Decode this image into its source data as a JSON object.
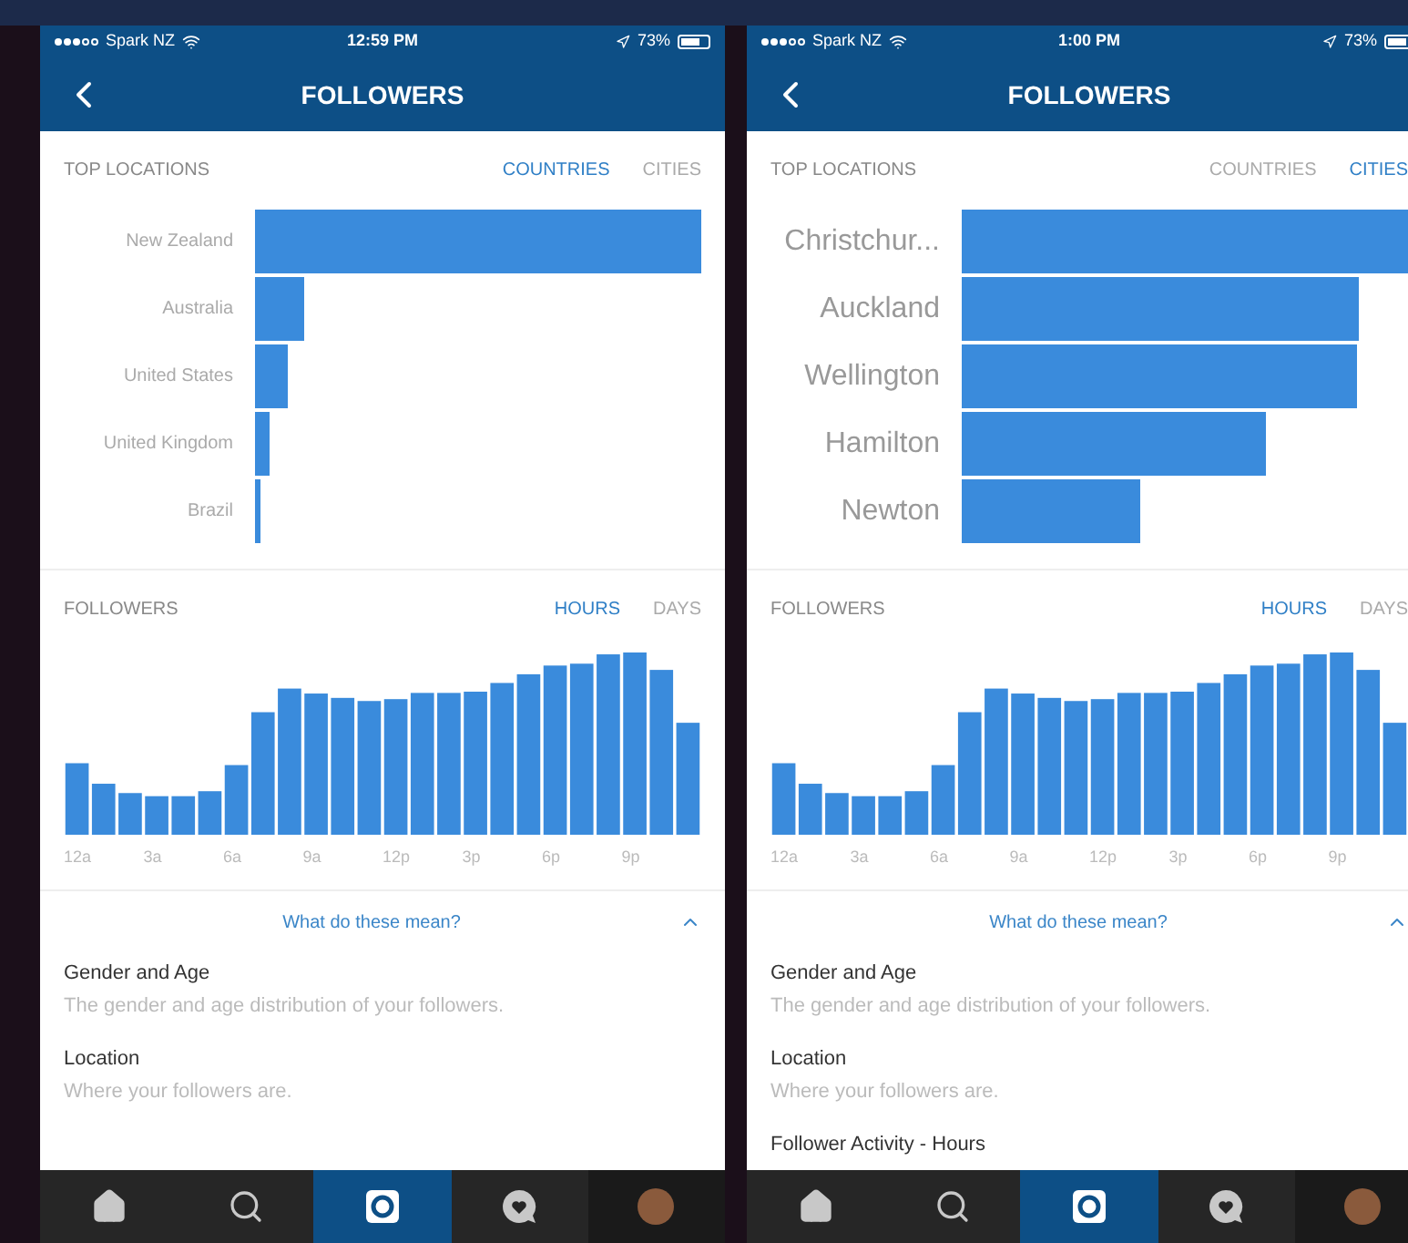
{
  "screens": [
    {
      "status_bar": {
        "carrier": "Spark NZ",
        "time": "12:59 PM",
        "battery": "73%"
      },
      "header": {
        "title": "FOLLOWERS"
      },
      "top_locations": {
        "title": "TOP LOCATIONS",
        "tabs": [
          {
            "label": "COUNTRIES",
            "selected": true
          },
          {
            "label": "CITIES",
            "selected": false
          }
        ],
        "rows": [
          {
            "label": "New Zealand"
          },
          {
            "label": "Australia"
          },
          {
            "label": "United States"
          },
          {
            "label": "United Kingdom"
          },
          {
            "label": "Brazil"
          }
        ]
      },
      "followers": {
        "title": "FOLLOWERS",
        "tabs": [
          {
            "label": "HOURS",
            "selected": true
          },
          {
            "label": "DAYS",
            "selected": false
          }
        ],
        "x_labels": [
          "12a",
          "3a",
          "6a",
          "9a",
          "12p",
          "3p",
          "6p",
          "9p"
        ]
      },
      "help": {
        "link": "What do these mean?",
        "expanded": true,
        "items": [
          {
            "title": "Gender and Age",
            "description": "The gender and age distribution of your followers."
          },
          {
            "title": "Location",
            "description": "Where your followers are."
          }
        ]
      },
      "tab_bar": [
        {
          "selected": false
        },
        {
          "selected": false
        },
        {
          "selected": true
        },
        {
          "selected": false
        },
        {
          "selected": false
        }
      ]
    },
    {
      "status_bar": {
        "carrier": "Spark NZ",
        "time": "1:00 PM",
        "battery": "73%"
      },
      "header": {
        "title": "FOLLOWERS"
      },
      "top_locations": {
        "title": "TOP LOCATIONS",
        "tabs": [
          {
            "label": "COUNTRIES",
            "selected": false
          },
          {
            "label": "CITIES",
            "selected": true
          }
        ],
        "rows": [
          {
            "label": "Christchur..."
          },
          {
            "label": "Auckland"
          },
          {
            "label": "Wellington"
          },
          {
            "label": "Hamilton"
          },
          {
            "label": "Newton"
          }
        ]
      },
      "followers": {
        "title": "FOLLOWERS",
        "tabs": [
          {
            "label": "HOURS",
            "selected": true
          },
          {
            "label": "DAYS",
            "selected": false
          }
        ],
        "x_labels": [
          "12a",
          "3a",
          "6a",
          "9a",
          "12p",
          "3p",
          "6p",
          "9p"
        ]
      },
      "help": {
        "link": "What do these mean?",
        "expanded": true,
        "items": [
          {
            "title": "Gender and Age",
            "description": "The gender and age distribution of your followers."
          },
          {
            "title": "Location",
            "description": "Where your followers are."
          },
          {
            "title": "Follower Activity - Hours"
          }
        ]
      },
      "tab_bar": [
        {
          "selected": false
        },
        {
          "selected": false
        },
        {
          "selected": true
        },
        {
          "selected": false
        },
        {
          "selected": false
        }
      ]
    }
  ]
}
